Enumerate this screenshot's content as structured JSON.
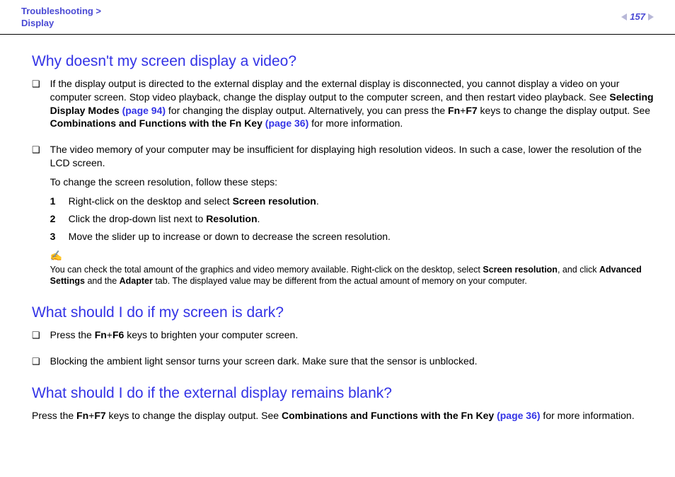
{
  "header": {
    "breadcrumb_top": "Troubleshooting >",
    "breadcrumb_bottom": "Display",
    "page_number": "157"
  },
  "q1": {
    "title": "Why doesn't my screen display a video?",
    "item1": {
      "p1a": "If the display output is directed to the external display and the external display is disconnected, you cannot display a video on your computer screen. Stop video playback, change the display output to the computer screen, and then restart video playback. See ",
      "p1b": "Selecting Display Modes ",
      "p1c": "(page 94)",
      "p1d": " for changing the display output. Alternatively, you can press the ",
      "p1e": "Fn",
      "p1f": "+",
      "p1g": "F7",
      "p1h": " keys to change the display output. See ",
      "p1i": "Combinations and Functions with the Fn Key ",
      "p1j": "(page 36)",
      "p1k": " for more information."
    },
    "item2": {
      "p1": "The video memory of your computer may be insufficient for displaying high resolution videos. In such a case, lower the resolution of the LCD screen.",
      "p2": "To change the screen resolution, follow these steps:",
      "steps": [
        {
          "num": "1",
          "a": "Right-click on the desktop and select ",
          "b": "Screen resolution",
          "c": "."
        },
        {
          "num": "2",
          "a": "Click the drop-down list next to ",
          "b": "Resolution",
          "c": "."
        },
        {
          "num": "3",
          "a": "Move the slider up to increase or down to decrease the screen resolution.",
          "b": "",
          "c": ""
        }
      ],
      "note_icon": "✍",
      "note_a": "You can check the total amount of the graphics and video memory available. Right-click on the desktop, select ",
      "note_b": "Screen resolution",
      "note_c": ", and click ",
      "note_d": "Advanced Settings",
      "note_e": " and the ",
      "note_f": "Adapter",
      "note_g": " tab. The displayed value may be different from the actual amount of memory on your computer."
    }
  },
  "q2": {
    "title": "What should I do if my screen is dark?",
    "item1_a": "Press the ",
    "item1_b": "Fn",
    "item1_c": "+",
    "item1_d": "F6",
    "item1_e": " keys to brighten your computer screen.",
    "item2": "Blocking the ambient light sensor turns your screen dark. Make sure that the sensor is unblocked."
  },
  "q3": {
    "title": "What should I do if the external display remains blank?",
    "p1a": "Press the ",
    "p1b": "Fn",
    "p1c": "+",
    "p1d": "F7",
    "p1e": " keys to change the display output. See ",
    "p1f": "Combinations and Functions with the Fn Key ",
    "p1g": "(page 36)",
    "p1h": " for more information."
  },
  "bullet": "❑"
}
